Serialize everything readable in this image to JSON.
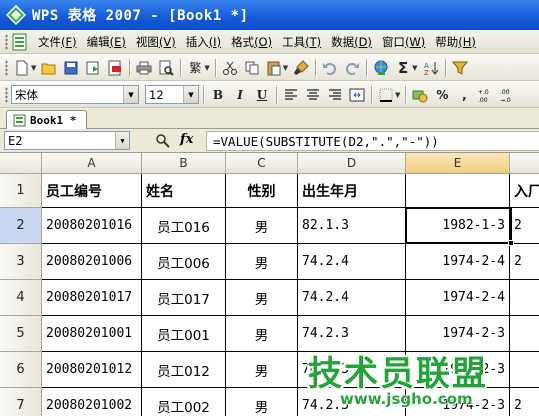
{
  "window": {
    "title": "WPS 表格 2007 - [Book1 *]"
  },
  "menu": {
    "items": [
      {
        "label": "文件",
        "accel": "(F)"
      },
      {
        "label": "编辑",
        "accel": "(E)"
      },
      {
        "label": "视图",
        "accel": "(V)"
      },
      {
        "label": "插入",
        "accel": "(I)"
      },
      {
        "label": "格式",
        "accel": "(O)"
      },
      {
        "label": "工具",
        "accel": "(T)"
      },
      {
        "label": "数据",
        "accel": "(D)"
      },
      {
        "label": "窗口",
        "accel": "(W)"
      },
      {
        "label": "帮助",
        "accel": "(H)"
      }
    ]
  },
  "toolbar": {
    "traditional_label": "繁",
    "bold_label": "B",
    "italic_label": "I",
    "underline_label": "U",
    "percent_label": "%"
  },
  "format_bar": {
    "font_name": "宋体",
    "font_size": "12"
  },
  "tabs": [
    {
      "label": "Book1 *"
    }
  ],
  "formula_bar": {
    "name_box": "E2",
    "fx_label": "fx",
    "formula": "=VALUE(SUBSTITUTE(D2,\".\",\"-\"))"
  },
  "sheet": {
    "columns": [
      "A",
      "B",
      "C",
      "D",
      "E"
    ],
    "header_row": [
      "员工编号",
      "姓名",
      "性别",
      "出生年月",
      "",
      "入厂"
    ],
    "rows": [
      {
        "num": "2",
        "a": "20080201016",
        "b": "员工016",
        "c": "男",
        "d": "82.1.3",
        "e": "1982-1-3",
        "f": "2"
      },
      {
        "num": "3",
        "a": "20080201006",
        "b": "员工006",
        "c": "男",
        "d": "74.2.4",
        "e": "1974-2-4",
        "f": "2"
      },
      {
        "num": "4",
        "a": "20080201017",
        "b": "员工017",
        "c": "男",
        "d": "74.2.4",
        "e": "1974-2-4",
        "f": ""
      },
      {
        "num": "5",
        "a": "20080201001",
        "b": "员工001",
        "c": "男",
        "d": "74.2.3",
        "e": "1974-2-3",
        "f": ""
      },
      {
        "num": "6",
        "a": "20080201012",
        "b": "员工012",
        "c": "男",
        "d": "74.2.3",
        "e": "1974-2-3",
        "f": ""
      },
      {
        "num": "7",
        "a": "20080201002",
        "b": "员工002",
        "c": "男",
        "d": "74.2.3",
        "e": "1974-2-3",
        "f": "2"
      }
    ],
    "header_row_num": "1",
    "active_cell": "E2"
  },
  "watermark": {
    "title": "技术员联盟",
    "url": "www.jsgho.com"
  },
  "colors": {
    "title_bar": "#1458d6",
    "grid_line": "#000000",
    "active_header": "#f1ce83",
    "watermark": "#23a33a"
  }
}
